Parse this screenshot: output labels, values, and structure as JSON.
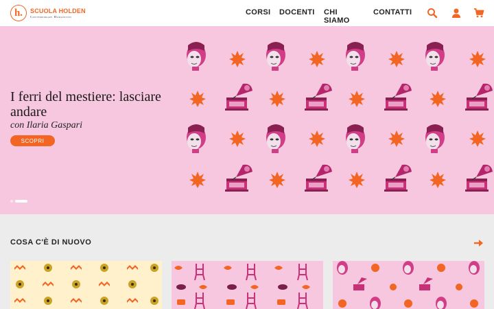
{
  "logo": {
    "mark": "h.",
    "name": "SCUOLA HOLDEN",
    "tagline": "Contemporary Humanities"
  },
  "nav": {
    "items": [
      {
        "label": "CORSI"
      },
      {
        "label": "DOCENTI"
      },
      {
        "label": "CHI SIAMO"
      },
      {
        "label": "CONTATTI"
      }
    ]
  },
  "tools": {
    "icons": [
      "search-icon",
      "user-icon",
      "cart-icon"
    ],
    "color": "#f26522"
  },
  "hero": {
    "title": "I ferri del mestiere: lasciare andare",
    "subtitle": "con Ilaria Gaspari",
    "button_label": "SCOPRI",
    "background": "#f6c7de",
    "slides_count": 2,
    "active_slide": 2
  },
  "news": {
    "title": "COSA C'È DI NUOVO",
    "cards": [
      {
        "pattern": "zigzag-gramophone-flowers",
        "background": "#fff1cc"
      },
      {
        "pattern": "chairs-lips-muffins",
        "background": "#f6c7de"
      },
      {
        "pattern": "statues-gramophones-suns",
        "background": "#f6c7de"
      }
    ]
  },
  "colors": {
    "accent": "#f26522",
    "magenta": "#c8317a",
    "page_bg": "#ececec"
  }
}
